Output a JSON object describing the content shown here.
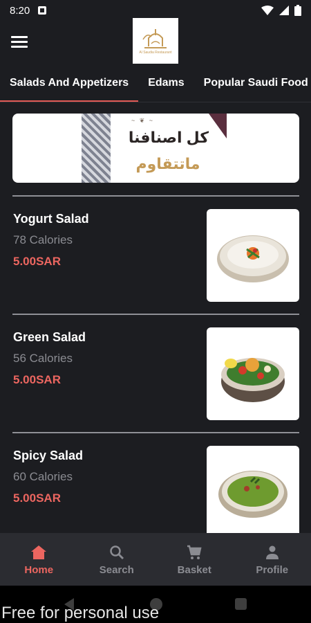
{
  "status_bar": {
    "time": "8:20"
  },
  "logo": {
    "tagline": "Al Saudia Restaurant"
  },
  "tabs": [
    {
      "label": "Salads And Appetizers",
      "active": true
    },
    {
      "label": "Edams",
      "active": false
    },
    {
      "label": "Popular Saudi Food",
      "active": false
    }
  ],
  "banner": {
    "title": "كل اصنافنا",
    "subtitle": "ماتتقاوم"
  },
  "items": [
    {
      "name": "Yogurt Salad",
      "calories": "78 Calories",
      "price": "5.00SAR",
      "image_icon": "yogurt-salad-bowl"
    },
    {
      "name": "Green Salad",
      "calories": "56 Calories",
      "price": "5.00SAR",
      "image_icon": "green-salad-bowl"
    },
    {
      "name": "Spicy Salad",
      "calories": "60 Calories",
      "price": "5.00SAR",
      "image_icon": "spicy-salad-bowl"
    }
  ],
  "bottom_nav": [
    {
      "label": "Home",
      "icon": "home-icon",
      "active": true
    },
    {
      "label": "Search",
      "icon": "search-icon",
      "active": false
    },
    {
      "label": "Basket",
      "icon": "cart-icon",
      "active": false
    },
    {
      "label": "Profile",
      "icon": "person-icon",
      "active": false
    }
  ],
  "watermark": "Free for personal use",
  "colors": {
    "background": "#1c1d21",
    "accent": "#ec6660",
    "muted": "#8b8c92",
    "nav_bg": "#2b2c31"
  }
}
